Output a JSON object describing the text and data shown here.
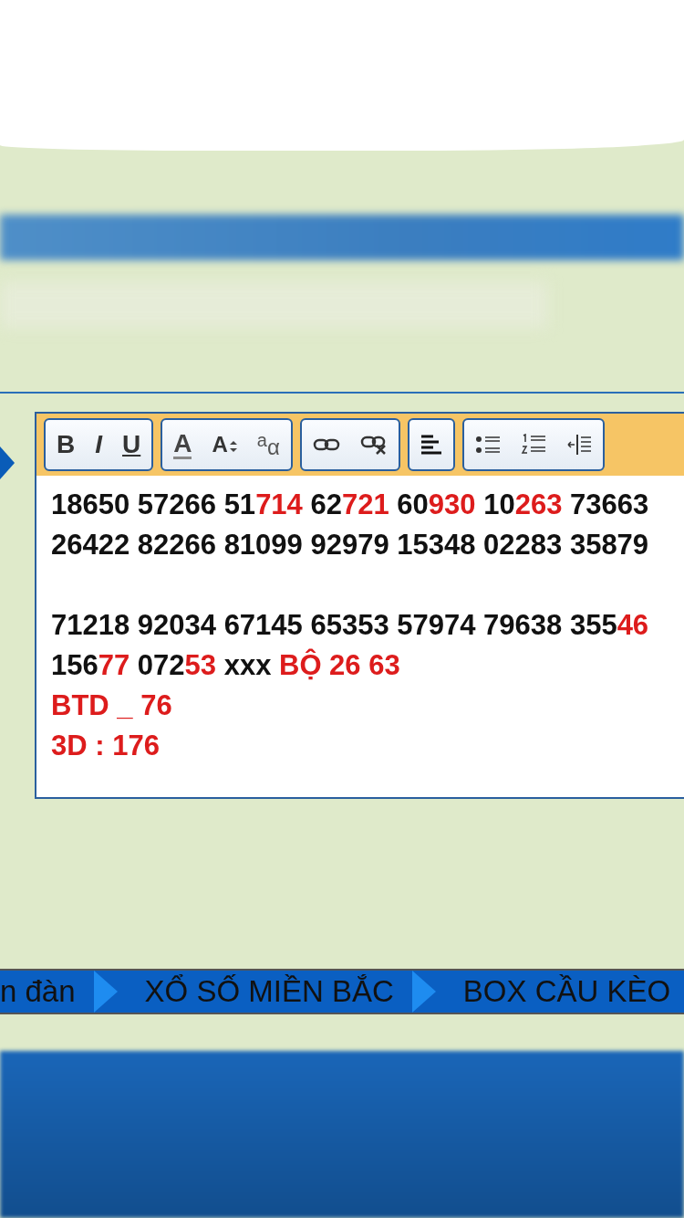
{
  "toolbar": {
    "groups": [
      {
        "buttons": [
          {
            "kind": "bold",
            "label": "B"
          },
          {
            "kind": "italic",
            "label": "I"
          },
          {
            "kind": "underline",
            "label": "U"
          }
        ]
      },
      {
        "buttons": [
          {
            "kind": "font-color",
            "label": "A"
          },
          {
            "kind": "font-size",
            "label": "A"
          },
          {
            "kind": "format",
            "label": "$^{a}$α"
          }
        ]
      },
      {
        "buttons": [
          {
            "kind": "link"
          },
          {
            "kind": "unlink"
          }
        ]
      },
      {
        "buttons": [
          {
            "kind": "align-left"
          }
        ]
      },
      {
        "buttons": [
          {
            "kind": "bullet-list"
          },
          {
            "kind": "numbered-list"
          },
          {
            "kind": "outdent"
          }
        ]
      }
    ]
  },
  "editor": {
    "lines": [
      {
        "gap_before": false,
        "segments": [
          {
            "text": "18650 57266 51",
            "red": false
          },
          {
            "text": "714",
            "red": true
          },
          {
            "text": " 62",
            "red": false
          },
          {
            "text": "721",
            "red": true
          },
          {
            "text": " 60",
            "red": false
          },
          {
            "text": "930",
            "red": true
          },
          {
            "text": " 10",
            "red": false
          },
          {
            "text": "263",
            "red": true
          },
          {
            "text": " 73663",
            "red": false
          }
        ]
      },
      {
        "gap_before": false,
        "segments": [
          {
            "text": "26422 82266 81099 92979 15348 02283 35879",
            "red": false
          }
        ]
      },
      {
        "gap_before": true,
        "segments": [
          {
            "text": "71218 92034 67145  65353 57974 79638 355",
            "red": false
          },
          {
            "text": "46",
            "red": true
          }
        ]
      },
      {
        "gap_before": false,
        "segments": [
          {
            "text": "156",
            "red": false
          },
          {
            "text": "77",
            "red": true
          },
          {
            "text": " 072",
            "red": false
          },
          {
            "text": "53",
            "red": true
          },
          {
            "text": " xxx ",
            "red": false
          },
          {
            "text": "BỘ 26 63",
            "red": true
          }
        ]
      },
      {
        "gap_before": false,
        "segments": [
          {
            "text": "BTD _ 76",
            "red": true
          }
        ]
      },
      {
        "gap_before": false,
        "segments": [
          {
            "text": "3D : 176",
            "red": true
          }
        ]
      }
    ]
  },
  "breadcrumb": [
    "n đàn",
    "XỔ SỐ MIỀN BẮC",
    "BOX CẦU KÈO"
  ]
}
